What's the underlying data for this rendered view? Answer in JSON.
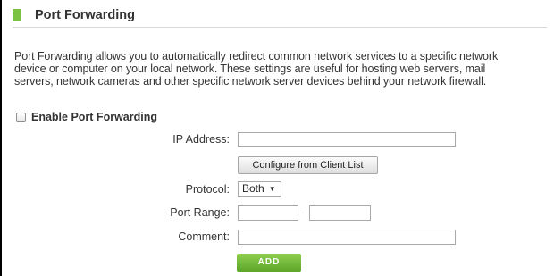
{
  "colors": {
    "accent_green": "#7cc242",
    "add_button_top": "#8fd04f",
    "add_button_bottom": "#5ca62a"
  },
  "header": {
    "title": "Port Forwarding"
  },
  "description": {
    "line1": "Port Forwarding allows you to automatically redirect common network services to a specific network",
    "line2": "device or computer on your local network. These settings are useful for hosting web servers, mail",
    "line3": "servers, network cameras and other specific network server devices behind your network firewall."
  },
  "enable_port_forwarding": {
    "label": "Enable Port Forwarding",
    "checked": false
  },
  "form": {
    "ip_address_label": "IP Address:",
    "ip_address_value": "",
    "configure_button_label": "Configure from Client List",
    "protocol_label": "Protocol:",
    "protocol_value": "Both",
    "port_range_label": "Port Range:",
    "port_range_start": "",
    "port_range_separator": "-",
    "port_range_end": "",
    "comment_label": "Comment:",
    "comment_value": "",
    "add_button_label": "ADD"
  }
}
